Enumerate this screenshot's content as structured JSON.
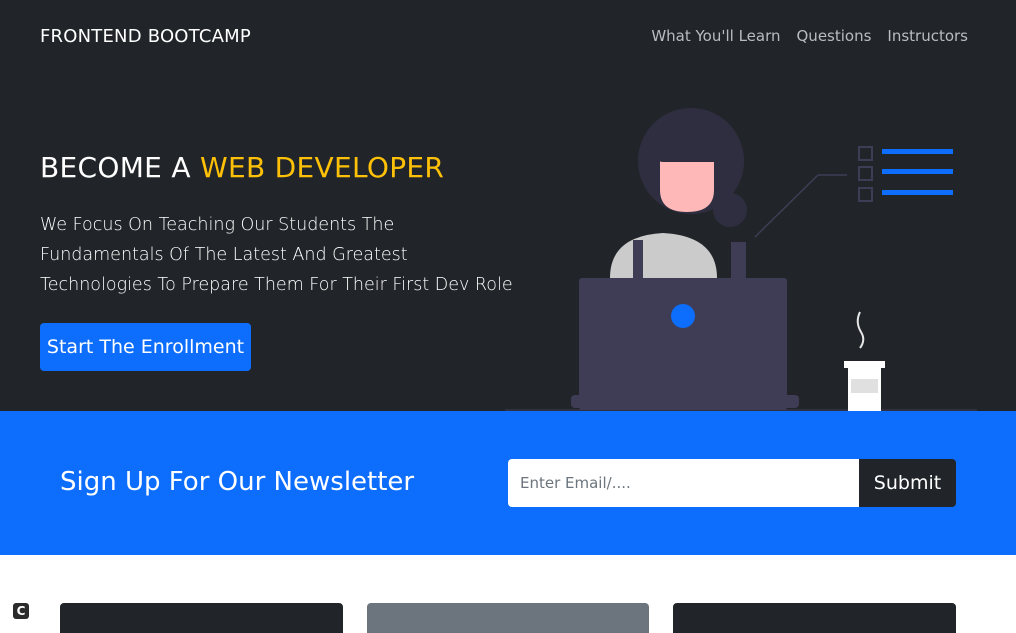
{
  "navbar": {
    "brand": "FRONTEND BOOTCAMP",
    "links": [
      "What You'll Learn",
      "Questions",
      "Instructors"
    ]
  },
  "hero": {
    "title_prefix": "BECOME A ",
    "title_accent": "WEB DEVELOPER",
    "text": "We Focus On Teaching Our Students The Fundamentals Of The Latest And Greatest Technologies To Prepare Them For Their First Dev Role",
    "button_label": "Start The Enrollment",
    "illustration": "developer-at-laptop-illustration"
  },
  "newsletter": {
    "title": "Sign Up For Our Newsletter",
    "email_placeholder": "Enter Email/....",
    "email_value": "",
    "submit_label": "Submit"
  },
  "badge": "C",
  "colors": {
    "dark": "#212529",
    "primary": "#0d6efd",
    "accent": "#ffc107",
    "secondary": "#6c757d",
    "white": "#ffffff"
  }
}
